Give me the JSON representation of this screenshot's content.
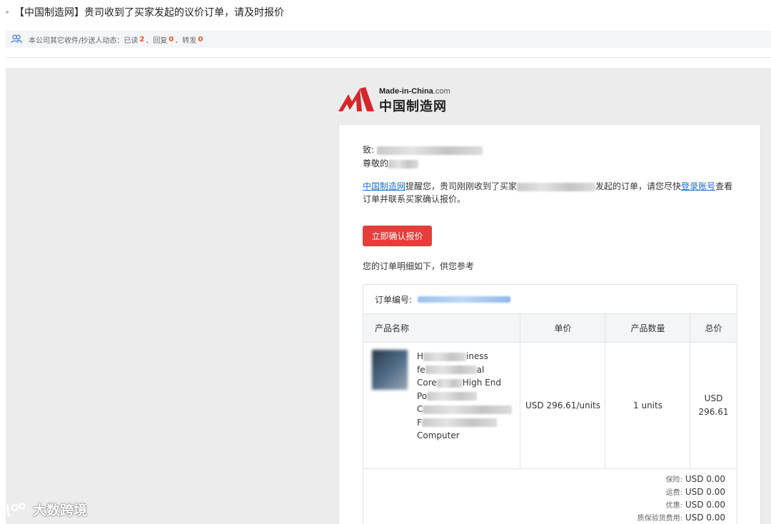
{
  "email": {
    "subject": "【中国制造网】贵司收到了买家发起的议价订单，请及时报价",
    "activity": {
      "prefix": "本公司其它收件/抄送人动态：已读",
      "read": "2",
      "reply_label": "、回复",
      "reply": "0",
      "forward_label": "、转发",
      "forward": "0"
    }
  },
  "logo": {
    "en_text": "Made-in-China",
    "com_text": ".com",
    "cn_text": "中国制造网",
    "brand_color": "#d7262b"
  },
  "message": {
    "to_label": "致:",
    "greeting_label": "尊敬的",
    "notice_link": "中国制造网",
    "notice_mid": "提醒您，贵司刚刚收到了买家",
    "notice_mid2": "发起的订单，请您尽快",
    "login_link": "登录账号",
    "notice_end": "查看订单并联系买家确认报价。",
    "confirm_button": "立即确认报价",
    "details_intro": "您的订单明细如下，供您参考"
  },
  "order": {
    "number_label": "订单编号:",
    "columns": [
      "产品名称",
      "单价",
      "产品数量",
      "总价"
    ],
    "item": {
      "name_lines": [
        "H",
        "fe",
        "Core",
        "Po",
        "C",
        "F",
        "Computer"
      ],
      "name_tails": [
        "iness",
        "al",
        "High End",
        "",
        "",
        "",
        ""
      ],
      "unit_price": "USD 296.61/units",
      "quantity": "1 units",
      "total_line1": "USD",
      "total_line2": "296.61"
    },
    "fees": [
      {
        "label": "保险:",
        "value": "USD 0.00"
      },
      {
        "label": "运费:",
        "value": "USD 0.00"
      },
      {
        "label": "优惠:",
        "value": "USD 0.00"
      },
      {
        "label": "质保验货费用:",
        "value": "USD 0.00"
      }
    ]
  },
  "watermark": {
    "text": "大数跨境"
  },
  "colors": {
    "accent_red": "#e43e3b",
    "link_blue": "#1a6fd0",
    "count_orange": "#e8541e"
  }
}
